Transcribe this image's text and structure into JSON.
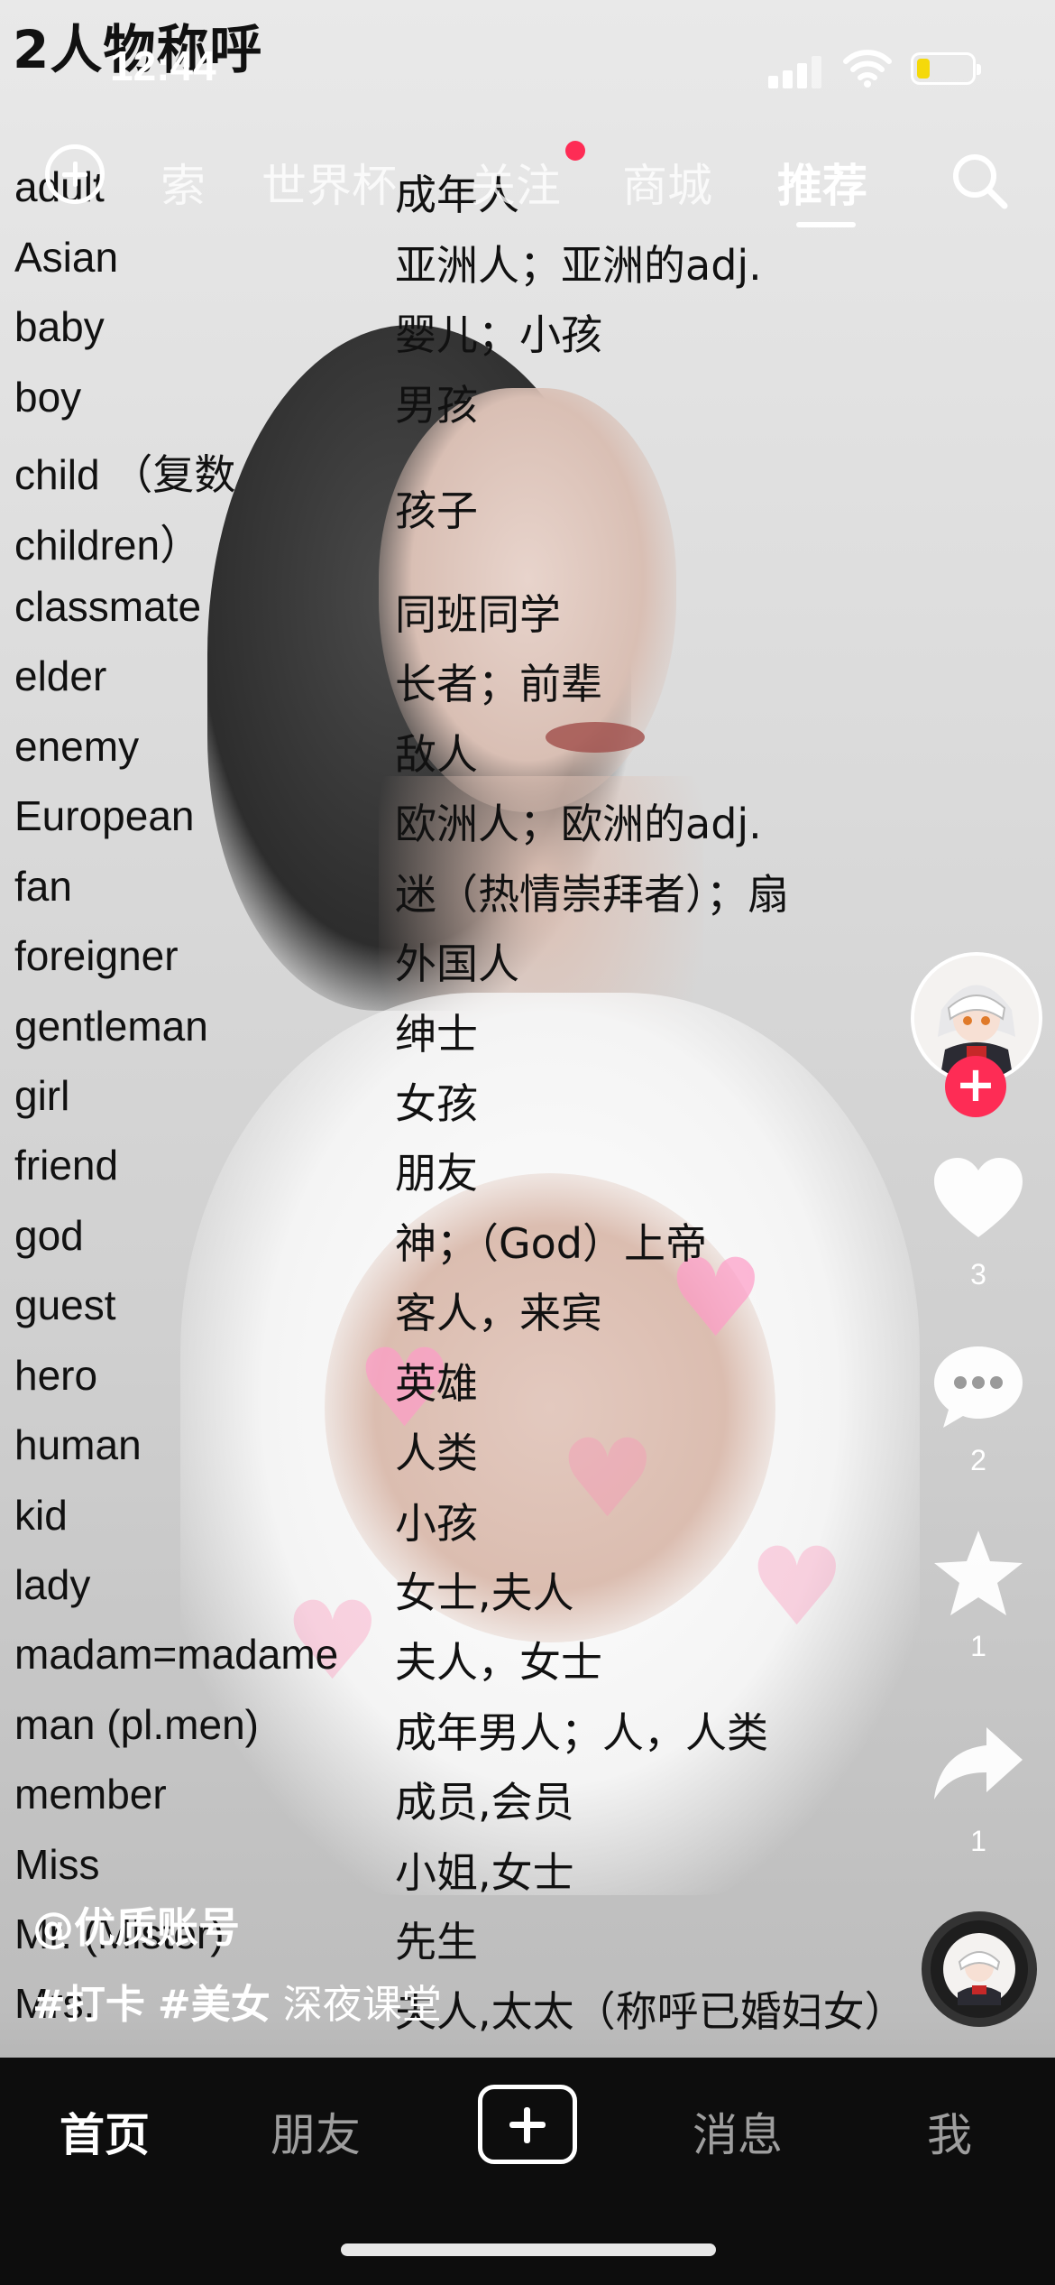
{
  "status_bar": {
    "time": "12:44"
  },
  "video": {
    "title": "2人物称呼",
    "vocab": [
      {
        "en": "adult",
        "zh": "成年人"
      },
      {
        "en": "Asian",
        "zh": "亚洲人；亚洲的adj."
      },
      {
        "en": "baby",
        "zh": "婴儿；小孩"
      },
      {
        "en": "boy",
        "zh": "男孩"
      },
      {
        "en": "child （复数",
        "zh": ""
      },
      {
        "en": "children）",
        "zh": "孩子"
      },
      {
        "en": "classmate",
        "zh": "同班同学"
      },
      {
        "en": "elder",
        "zh": "长者；前辈"
      },
      {
        "en": "enemy",
        "zh": "敌人"
      },
      {
        "en": "European",
        "zh": "欧洲人；欧洲的adj."
      },
      {
        "en": "fan",
        "zh": "迷（热情崇拜者）；扇"
      },
      {
        "en": "foreigner",
        "zh": "外国人"
      },
      {
        "en": "gentleman",
        "zh": "绅士"
      },
      {
        "en": "girl",
        "zh": "女孩"
      },
      {
        "en": "friend",
        "zh": "朋友"
      },
      {
        "en": "god",
        "zh": "神；（God）上帝"
      },
      {
        "en": "guest",
        "zh": "客人，来宾"
      },
      {
        "en": "hero",
        "zh": "英雄"
      },
      {
        "en": "human",
        "zh": "人类"
      },
      {
        "en": "kid",
        "zh": "小孩"
      },
      {
        "en": "lady",
        "zh": "女士,夫人"
      },
      {
        "en": "madam=madame",
        "zh": "夫人，女士"
      },
      {
        "en": "man (pl.men)",
        "zh": "成年男人；人，人类"
      },
      {
        "en": "member",
        "zh": "成员,会员"
      },
      {
        "en": "Miss",
        "zh": "小姐,女士"
      },
      {
        "en": "Mr. (Mister)",
        "zh": "先生"
      },
      {
        "en": "Mrs.",
        "zh": "夫人,太太（称呼已婚妇女）"
      }
    ]
  },
  "top_nav": {
    "tabs": [
      "索",
      "世界杯",
      "关注",
      "商城",
      "推荐"
    ],
    "active_tab": "推荐"
  },
  "right_rail": {
    "likes": "3",
    "comments": "2",
    "favorites": "1",
    "shares": "1",
    "follow_symbol": "+"
  },
  "post": {
    "author": "@优质账号",
    "hashtags": [
      "#打卡",
      "#美女"
    ],
    "text": "深夜课堂"
  },
  "bottom_nav": {
    "home": "首页",
    "friends": "朋友",
    "messages": "消息",
    "me": "我"
  },
  "colors": {
    "accent": "#fe2c55",
    "battery": "#f5d90a",
    "nav_bg": "#0d0d0d"
  }
}
